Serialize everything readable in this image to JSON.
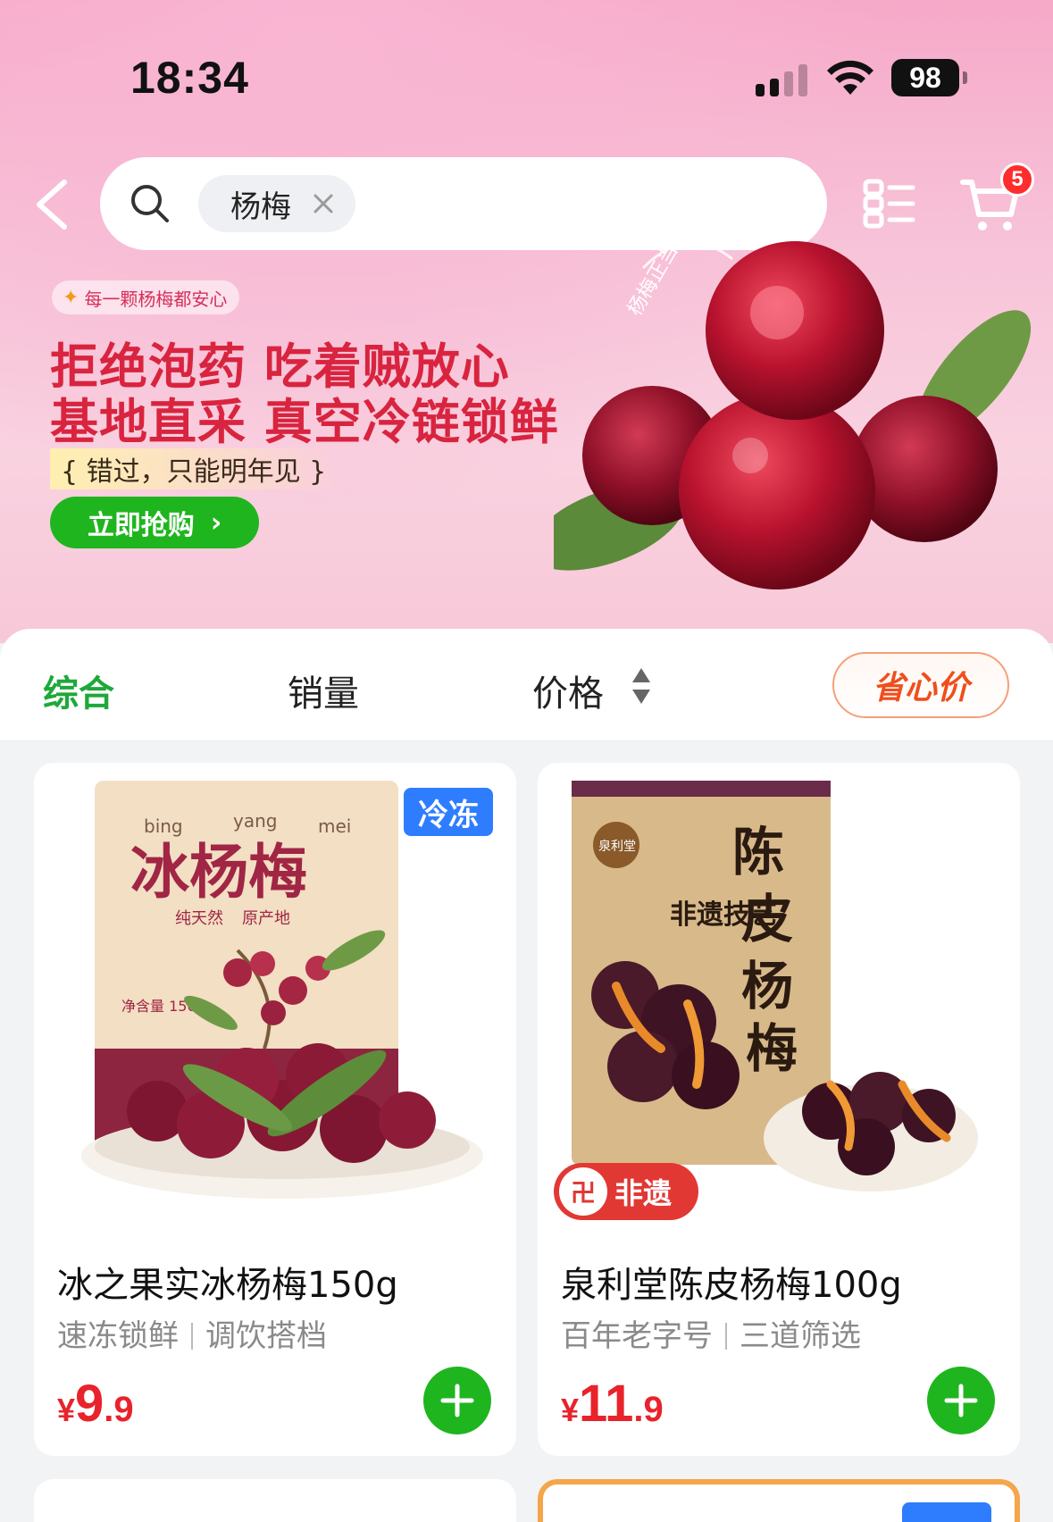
{
  "status_bar": {
    "time": "18:34",
    "battery": "98"
  },
  "search": {
    "query": "杨梅"
  },
  "cart": {
    "badge_count": "5"
  },
  "banner": {
    "tag": "每一颗杨梅都安心",
    "line1": "拒绝泡药 吃着贼放心",
    "line2": "基地直采 真空冷链锁鲜",
    "subtitle": "{ 错过，只能明年见 }",
    "button": "立即抢购",
    "art_label": "杨梅正当季"
  },
  "sort_bar": {
    "tabs": [
      {
        "label": "综合",
        "active": true
      },
      {
        "label": "销量",
        "active": false
      },
      {
        "label": "价格",
        "active": false
      }
    ],
    "price_filter": "省心价"
  },
  "products": [
    {
      "title": "冰之果实冰杨梅150g",
      "tags": [
        "速冻锁鲜",
        "调饮搭档"
      ],
      "price_int": "9",
      "price_dec": ".9",
      "badge": "冷冻",
      "package_text": {
        "pinyin": [
          "bing",
          "yang",
          "mei"
        ],
        "name": "冰杨梅",
        "labels": [
          "纯天然",
          "原产地"
        ],
        "weight": "净含量 150g"
      }
    },
    {
      "title": "泉利堂陈皮杨梅100g",
      "tags": [
        "百年老字号",
        "三道筛选"
      ],
      "price_int": "11",
      "price_dec": ".9",
      "badge": "非遗",
      "package_text": {
        "brand": "泉利堂",
        "name": "陈皮杨梅",
        "craft": "非遗技艺"
      }
    }
  ],
  "colors": {
    "accent_green": "#1fb51f",
    "price_red": "#e8232b",
    "banner_red": "#d9243f",
    "frozen_blue": "#2f7dff"
  },
  "icons": {
    "back": "chevron-left-icon",
    "search": "search-icon",
    "clear": "close-icon",
    "list_view": "list-view-icon",
    "cart": "cart-icon",
    "add": "plus-icon"
  }
}
